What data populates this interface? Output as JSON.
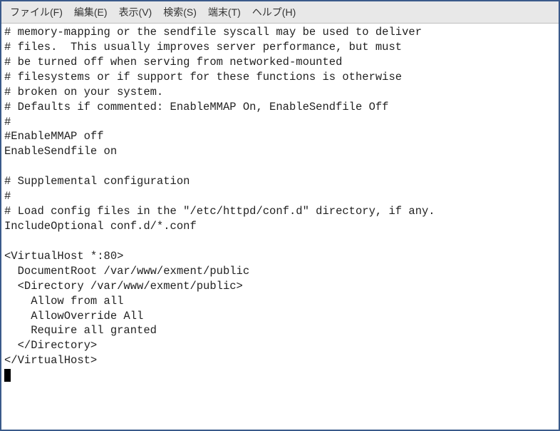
{
  "menubar": {
    "items": [
      {
        "label": "ファイル(F)"
      },
      {
        "label": "編集(E)"
      },
      {
        "label": "表示(V)"
      },
      {
        "label": "検索(S)"
      },
      {
        "label": "端末(T)"
      },
      {
        "label": "ヘルプ(H)"
      }
    ]
  },
  "terminal": {
    "lines": [
      "# memory-mapping or the sendfile syscall may be used to deliver",
      "# files.  This usually improves server performance, but must",
      "# be turned off when serving from networked-mounted",
      "# filesystems or if support for these functions is otherwise",
      "# broken on your system.",
      "# Defaults if commented: EnableMMAP On, EnableSendfile Off",
      "#",
      "#EnableMMAP off",
      "EnableSendfile on",
      "",
      "# Supplemental configuration",
      "#",
      "# Load config files in the \"/etc/httpd/conf.d\" directory, if any.",
      "IncludeOptional conf.d/*.conf",
      "",
      "<VirtualHost *:80>",
      "  DocumentRoot /var/www/exment/public",
      "  <Directory /var/www/exment/public>",
      "    Allow from all",
      "    AllowOverride All",
      "    Require all granted",
      "  </Directory>",
      "</VirtualHost>"
    ]
  }
}
